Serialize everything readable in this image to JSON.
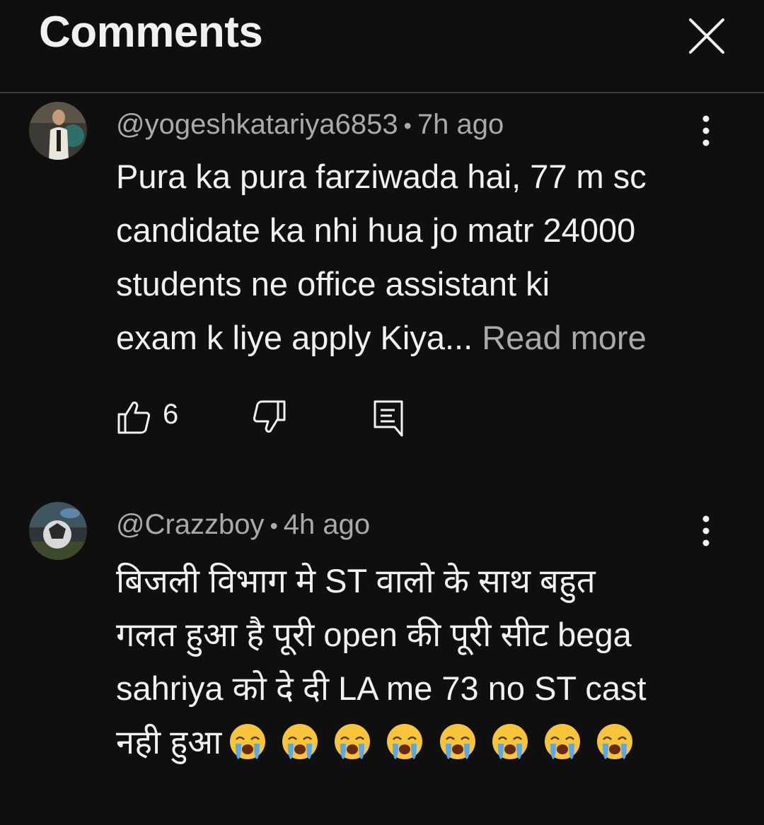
{
  "header": {
    "title": "Comments"
  },
  "icons": {
    "close": "close-icon",
    "more": "vertical-dots-icon",
    "like": "thumbs-up-icon",
    "dislike": "thumbs-down-icon",
    "reply": "reply-icon",
    "emoji": "loudly-crying-face"
  },
  "colors": {
    "background": "#0f0f0f",
    "text_primary": "#f1f1f1",
    "text_secondary": "#aaaaaa",
    "divider": "#3a3a3a"
  },
  "comments": [
    {
      "author": "@yogeshkatariya6853",
      "separator": "•",
      "time": "7h ago",
      "lines": [
        "Pura ka pura farziwada hai, 77 m sc",
        "candidate ka nhi hua jo matr 24000",
        "students ne office assistant ki",
        "exam k liye apply Kiya..."
      ],
      "read_more": "Read more",
      "likes": "6"
    },
    {
      "author": "@Crazzboy",
      "separator": "•",
      "time": "4h ago",
      "lines": [
        "बिजली विभाग मे ST वालो के साथ बहुत",
        "गलत हुआ है पूरी open की पूरी सीट bega",
        "sahriya को दे दी LA me 73 no ST cast",
        "नही हुआ"
      ],
      "emojis": "😭😭😭😭😭😭😭😭"
    }
  ]
}
